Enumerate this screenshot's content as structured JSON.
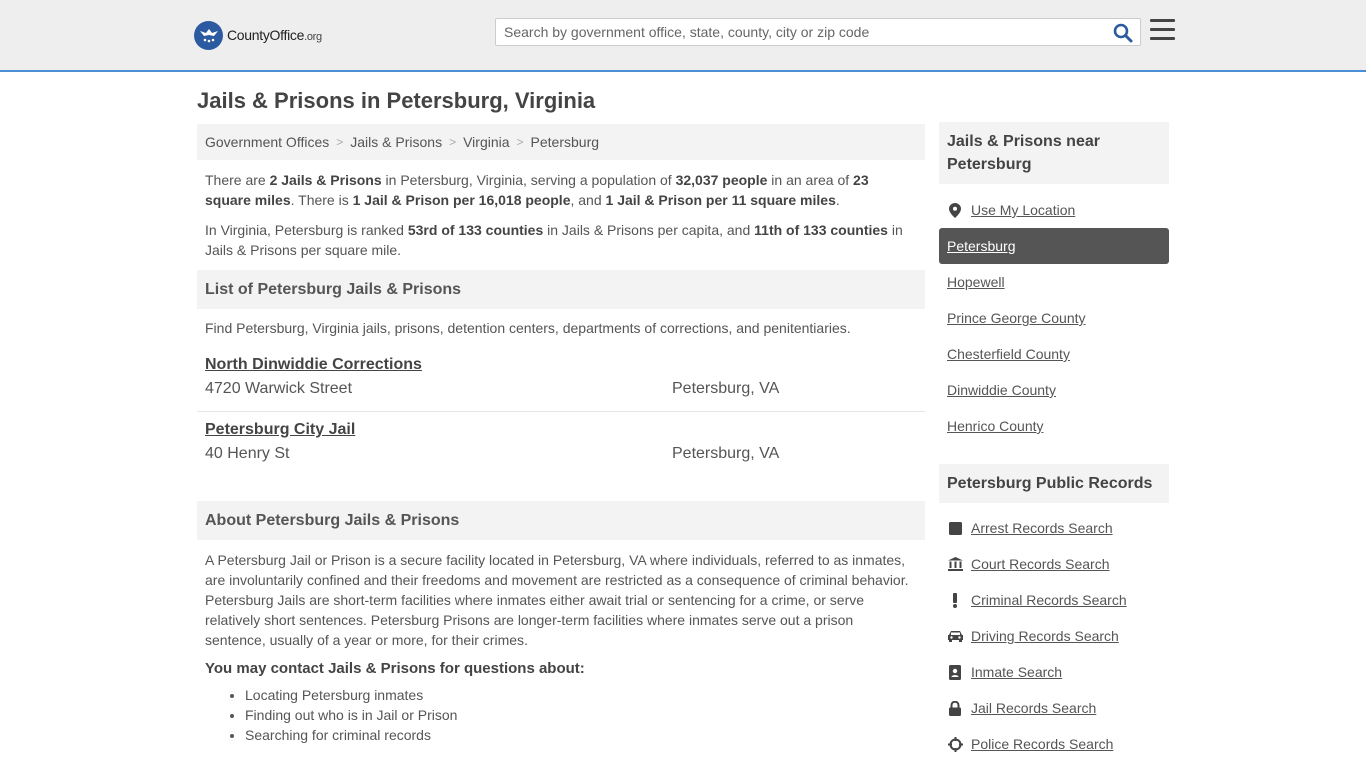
{
  "header": {
    "logo_text": "CountyOffice",
    "logo_tld": ".org",
    "search_placeholder": "Search by government office, state, county, city or zip code"
  },
  "page": {
    "title": "Jails & Prisons in Petersburg, Virginia"
  },
  "breadcrumb": [
    "Government Offices",
    "Jails & Prisons",
    "Virginia",
    "Petersburg"
  ],
  "summary": {
    "p1": {
      "t1": "There are ",
      "b1": "2 Jails & Prisons",
      "t2": " in Petersburg, Virginia, serving a population of ",
      "b2": "32,037 people",
      "t3": " in an area of ",
      "b3": "23 square miles",
      "t4": ". There is ",
      "b4": "1 Jail & Prison per 16,018 people",
      "t5": ", and ",
      "b5": "1 Jail & Prison per 11 square miles",
      "t6": "."
    },
    "p2": {
      "t1": "In Virginia, Petersburg is ranked ",
      "b1": "53rd of 133 counties",
      "t2": " in Jails & Prisons per capita, and ",
      "b2": "11th of 133 counties",
      "t3": " in Jails & Prisons per square mile."
    }
  },
  "list_section": {
    "heading": "List of Petersburg Jails & Prisons",
    "intro": "Find Petersburg, Virginia jails, prisons, detention centers, departments of corrections, and penitentiaries.",
    "items": [
      {
        "name": "North Dinwiddie Corrections",
        "address": "4720 Warwick Street",
        "city": "Petersburg, VA"
      },
      {
        "name": "Petersburg City Jail",
        "address": "40 Henry St",
        "city": "Petersburg, VA"
      }
    ]
  },
  "about_section": {
    "heading": "About Petersburg Jails & Prisons",
    "text": "A Petersburg Jail or Prison is a secure facility located in Petersburg, VA where individuals, referred to as inmates, are involuntarily confined and their freedoms and movement are restricted as a consequence of criminal behavior. Petersburg Jails are short-term facilities where inmates either await trial or sentencing for a crime, or serve relatively short sentences. Petersburg Prisons are longer-term facilities where inmates serve out a prison sentence, usually of a year or more, for their crimes.",
    "contact_heading": "You may contact Jails & Prisons for questions about:",
    "contact_items": [
      "Locating Petersburg inmates",
      "Finding out who is in Jail or Prison",
      "Searching for criminal records"
    ]
  },
  "sidebar": {
    "nearby_heading": "Jails & Prisons near Petersburg",
    "nearby": [
      {
        "label": "Use My Location",
        "icon": "location-pin-icon"
      },
      {
        "label": "Petersburg",
        "active": true
      },
      {
        "label": "Hopewell"
      },
      {
        "label": "Prince George County"
      },
      {
        "label": "Chesterfield County"
      },
      {
        "label": "Dinwiddie County"
      },
      {
        "label": "Henrico County"
      }
    ],
    "records_heading": "Petersburg Public Records",
    "records": [
      {
        "label": "Arrest Records Search",
        "icon": "square-icon"
      },
      {
        "label": "Court Records Search",
        "icon": "courthouse-icon"
      },
      {
        "label": "Criminal Records Search",
        "icon": "exclamation-icon"
      },
      {
        "label": "Driving Records Search",
        "icon": "car-icon"
      },
      {
        "label": "Inmate Search",
        "icon": "id-badge-icon"
      },
      {
        "label": "Jail Records Search",
        "icon": "lock-icon"
      },
      {
        "label": "Police Records Search",
        "icon": "crosshair-icon"
      }
    ]
  },
  "colors": {
    "accent": "#4a8fd6",
    "search_icon": "#2c5aa0",
    "panel_bg": "#f3f3f3",
    "active_bg": "#555555"
  }
}
